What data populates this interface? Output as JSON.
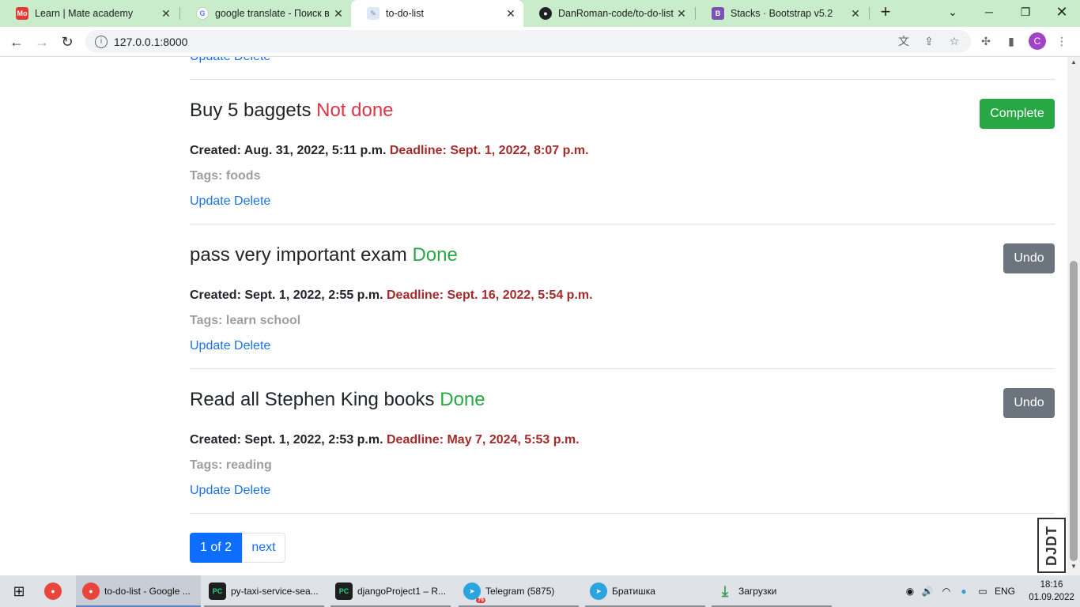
{
  "browser": {
    "tabs": [
      {
        "title": "Learn | Mate academy",
        "favicon": "Mo",
        "color": "#e53935"
      },
      {
        "title": "google translate - Поиск в G",
        "favicon": "G",
        "color": "#4285f4"
      },
      {
        "title": "to-do-list",
        "favicon": "doc",
        "color": "#6d8bbf"
      },
      {
        "title": "DanRoman-code/to-do-list: ",
        "favicon": "gh",
        "color": "#222"
      },
      {
        "title": "Stacks · Bootstrap v5.2",
        "favicon": "B",
        "color": "#7952b3"
      }
    ],
    "url": "127.0.0.1:8000",
    "profile_initial": "C"
  },
  "tasks": [
    {
      "title": "Buy 5 baggets",
      "status": "Not done",
      "created": "Created: Aug. 31, 2022, 5:11 p.m.",
      "deadline": "Deadline: Sept. 1, 2022, 8:07 p.m.",
      "tags": "Tags: foods",
      "button": "Complete",
      "update": "Update",
      "delete": "Delete"
    },
    {
      "title": "pass very important exam",
      "status": "Done",
      "created": "Created: Sept. 1, 2022, 2:55 p.m.",
      "deadline": "Deadline: Sept. 16, 2022, 5:54 p.m.",
      "tags": "Tags: learn school",
      "button": "Undo",
      "update": "Update",
      "delete": "Delete"
    },
    {
      "title": "Read all Stephen King books",
      "status": "Done",
      "created": "Created: Sept. 1, 2022, 2:53 p.m.",
      "deadline": "Deadline: May 7, 2024, 5:53 p.m.",
      "tags": "Tags: reading",
      "button": "Undo",
      "update": "Update",
      "delete": "Delete"
    }
  ],
  "top_links": {
    "update": "Update",
    "delete": "Delete"
  },
  "pagination": {
    "current": "1 of 2",
    "next": "next"
  },
  "djdt": "DJDT",
  "taskbar": {
    "items": [
      {
        "label": "to-do-list - Google ...",
        "icon": "chrome"
      },
      {
        "label": "py-taxi-service-sea...",
        "icon": "PC"
      },
      {
        "label": "djangoProject1 – R...",
        "icon": "PC"
      },
      {
        "label": "Telegram (5875)",
        "icon": "telegram",
        "badge": "75"
      },
      {
        "label": "Братишка",
        "icon": "telegram"
      },
      {
        "label": "Загрузки",
        "icon": "download"
      }
    ],
    "lang": "ENG",
    "time": "18:16",
    "date": "01.09.2022"
  }
}
